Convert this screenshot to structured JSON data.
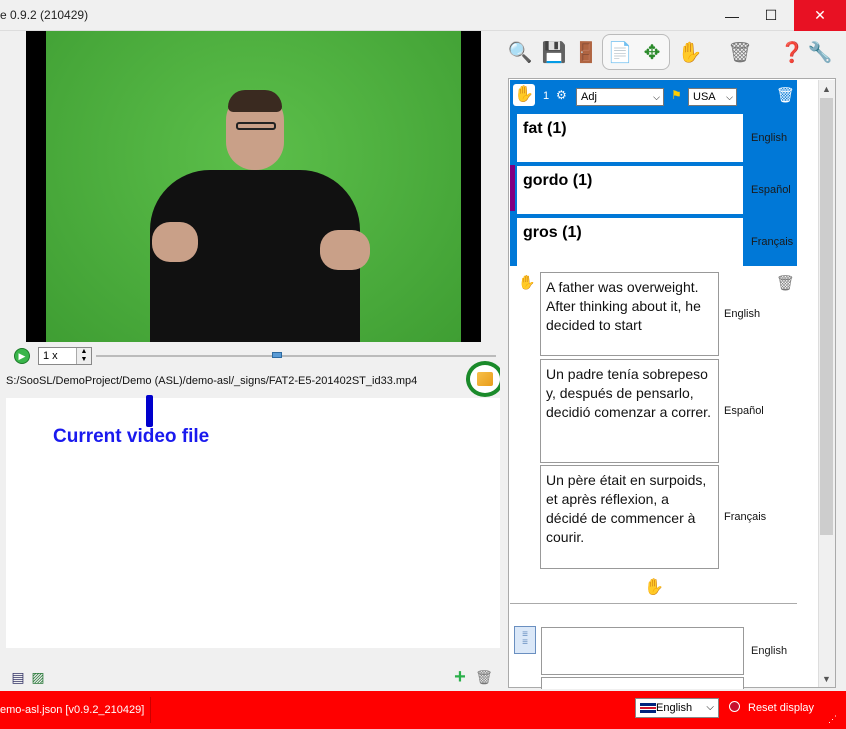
{
  "window": {
    "title": "e 0.9.2 (210429)",
    "minimize": "—",
    "maximize": "☐",
    "close": "✕"
  },
  "video": {
    "play_icon": "play-icon",
    "speed": "1 x",
    "file_path": "S:/SooSL/DemoProject/Demo (ASL)/demo-asl/_signs/FAT2-E5-201402ST_id33.mp4",
    "annotation": "Current video file"
  },
  "toolbar": {
    "icons": [
      "search-icon",
      "save-icon",
      "exit-icon",
      "document-icon",
      "compass-icon",
      "add-sign-icon",
      "trash-icon",
      "help-icon",
      "wrench-icon"
    ]
  },
  "sense": {
    "number": "1",
    "grammar_category": "Adj",
    "dialect": "USA",
    "glosses": [
      {
        "text": "fat (1)",
        "language": "English"
      },
      {
        "text": "gordo (1)",
        "language": "Español"
      },
      {
        "text": "gros (1)",
        "language": "Français"
      }
    ]
  },
  "sentences": [
    {
      "text": "A father was overweight. After thinking about it, he decided to start",
      "language": "English"
    },
    {
      "text": "Un padre tenía sobrepeso y, después de pensarlo, decidió comenzar a correr.",
      "language": "Español"
    },
    {
      "text": "Un père était en surpoids, et après réflexion, a décidé de commencer à courir.",
      "language": "Français"
    }
  ],
  "extra_text": {
    "language": "English"
  },
  "statusbar": {
    "file": "emo-asl.json [v0.9.2_210429]",
    "display_language": "English",
    "reset_label": "Reset display"
  },
  "colors": {
    "sense_block": "#0078d7",
    "status_bar": "#ff0000",
    "annotation": "#1a1aee",
    "highlight_ring": "#1a8a2a"
  }
}
